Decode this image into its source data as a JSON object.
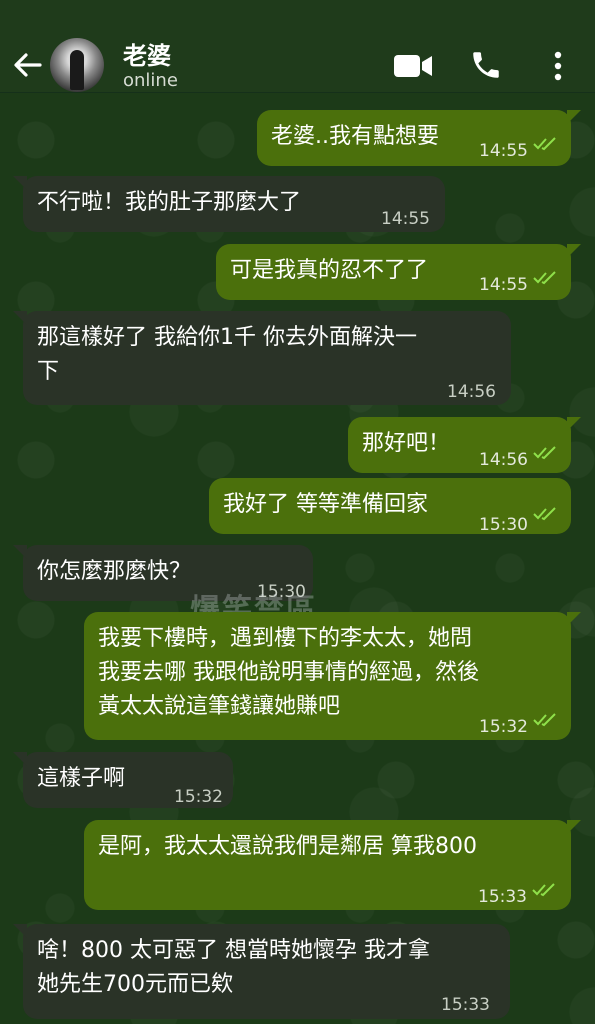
{
  "header": {
    "contact_name": "老婆",
    "status": "online",
    "icons": [
      "back-arrow-icon",
      "video-call-icon",
      "phone-icon",
      "more-vertical-icon"
    ]
  },
  "messages": [
    {
      "dir": "out",
      "text": "老婆..我有點想要",
      "time": "14:55",
      "read": true
    },
    {
      "dir": "in",
      "text": "不行啦！我的肚子那麼大了",
      "time": "14:55"
    },
    {
      "dir": "out",
      "text": "可是我真的忍不了了",
      "time": "14:55",
      "read": true
    },
    {
      "dir": "in",
      "lines": [
        "那這樣好了 我給你1千 你去外面解決一",
        "下"
      ],
      "time": "14:56"
    },
    {
      "dir": "out",
      "text": "那好吧！",
      "time": "14:56",
      "read": true
    },
    {
      "dir": "out",
      "text": "我好了 等等準備回家",
      "time": "15:30",
      "read": true
    },
    {
      "dir": "in",
      "text": "你怎麼那麼快？",
      "time": "15:30"
    },
    {
      "dir": "out",
      "lines": [
        "我要下樓時，遇到樓下的李太太，她問",
        "我要去哪 我跟他說明事情的經過，然後",
        "黃太太說這筆錢讓她賺吧"
      ],
      "time": "15:32",
      "read": true
    },
    {
      "dir": "in",
      "text": "這樣子啊",
      "time": "15:32"
    },
    {
      "dir": "out",
      "text": "是阿，我太太還說我們是鄰居 算我800",
      "time": "15:33",
      "read": true
    },
    {
      "dir": "in",
      "lines": [
        "啥！800 太可惡了 想當時她懷孕 我才拿",
        "她先生700元而已欸"
      ],
      "time": "15:33"
    }
  ],
  "watermark": "爆笑禁區",
  "colors": {
    "outgoing": "#4b700c",
    "incoming": "#2a3327",
    "tick": "#8fe04a"
  }
}
